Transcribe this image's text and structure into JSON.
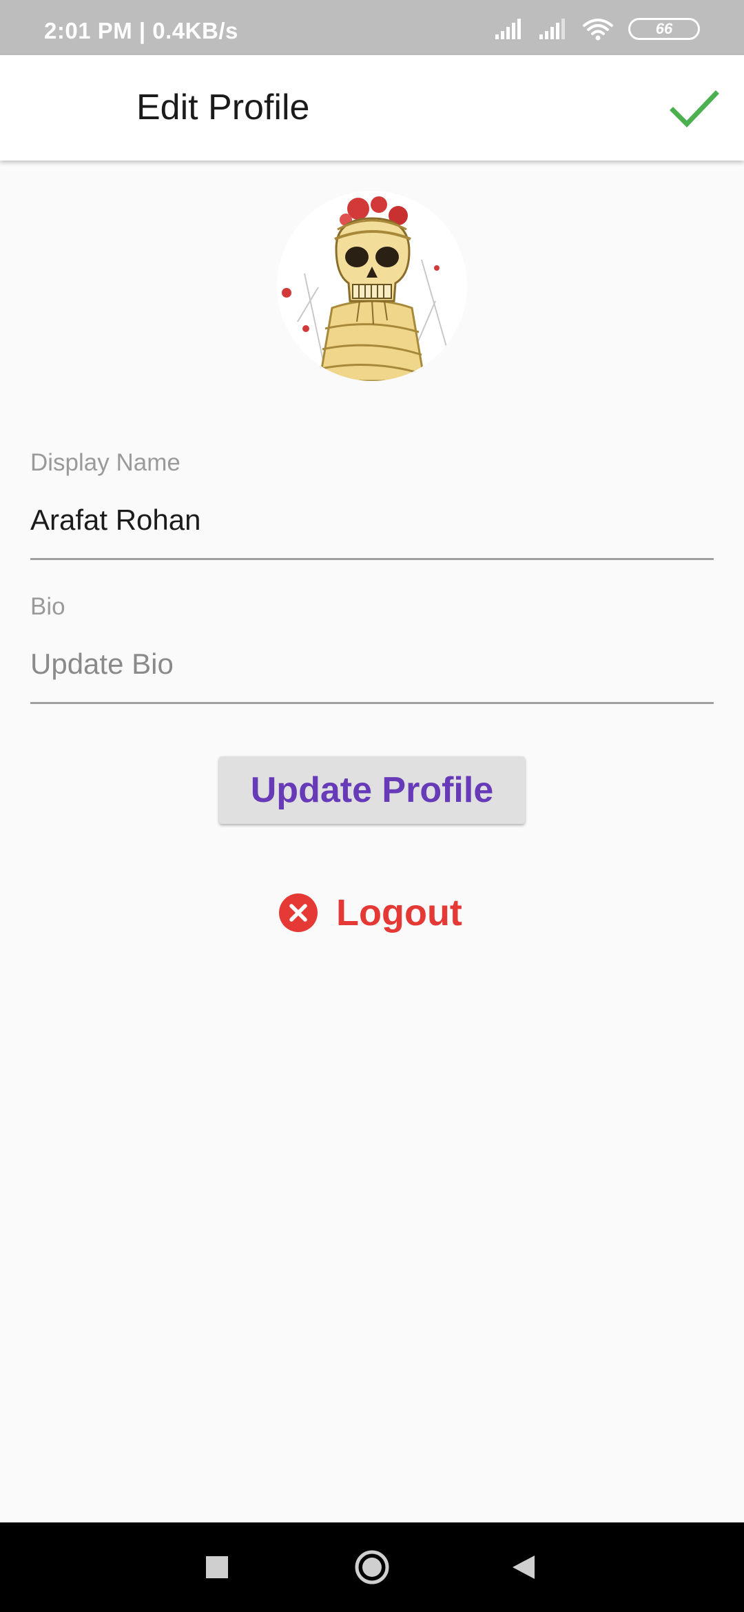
{
  "status_bar": {
    "time_and_speed": "2:01 PM | 0.4KB/s",
    "battery_level": "66",
    "icons": [
      "signal-icon",
      "signal-icon",
      "wifi-icon",
      "battery-icon"
    ]
  },
  "app_bar": {
    "title": "Edit Profile",
    "confirm_icon": "check-icon",
    "confirm_color": "#4caf50"
  },
  "profile": {
    "avatar_icon": "profile-avatar-image"
  },
  "form": {
    "display_name": {
      "label": "Display Name",
      "value": "Arafat Rohan",
      "placeholder": ""
    },
    "bio": {
      "label": "Bio",
      "value": "",
      "placeholder": "Update Bio"
    }
  },
  "actions": {
    "update_profile_label": "Update Profile",
    "update_profile_color": "#673ab7",
    "logout_label": "Logout",
    "logout_icon": "close-circle-icon",
    "logout_color": "#e53935"
  },
  "nav_bar": {
    "icons": [
      "recents-square-icon",
      "home-circle-icon",
      "back-triangle-icon"
    ]
  }
}
